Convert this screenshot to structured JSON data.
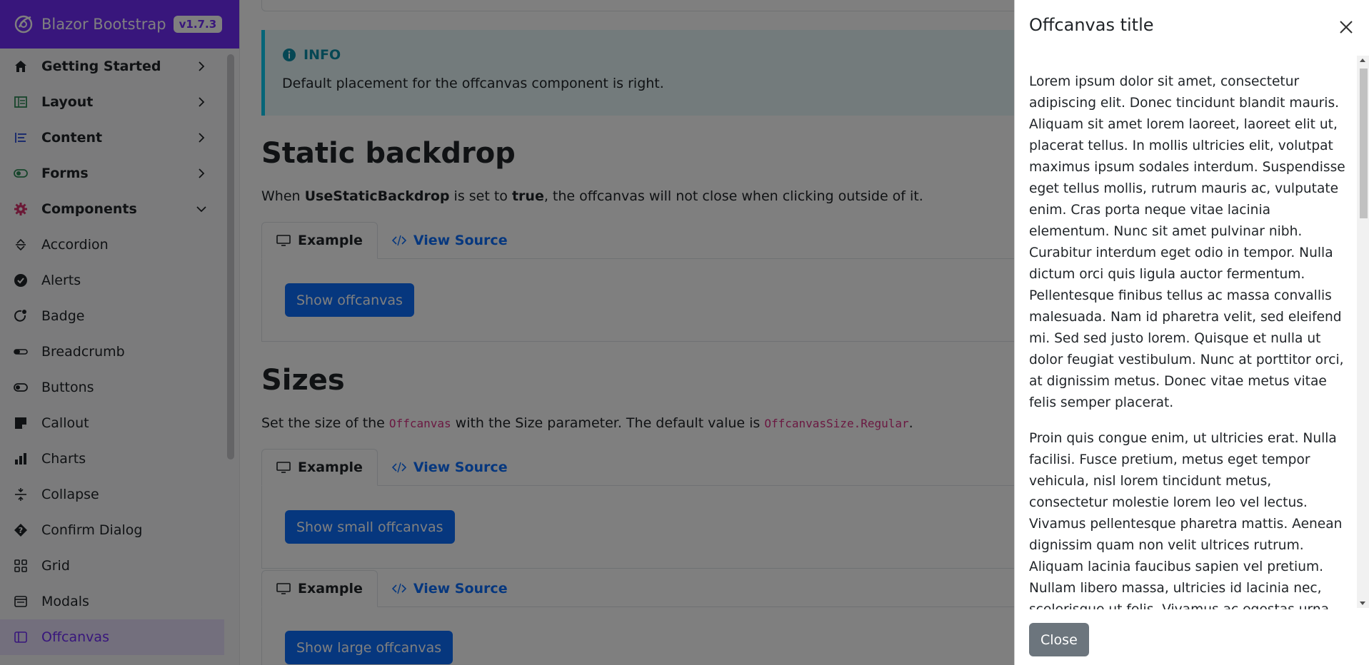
{
  "brand": {
    "name": "Blazor Bootstrap",
    "version": "v1.7.3"
  },
  "sidebar": {
    "items": [
      {
        "label": "Getting Started",
        "icon": "home-icon",
        "group": true,
        "expanded": false
      },
      {
        "label": "Layout",
        "icon": "layout-icon",
        "group": true,
        "expanded": false
      },
      {
        "label": "Content",
        "icon": "content-icon",
        "group": true,
        "expanded": false
      },
      {
        "label": "Forms",
        "icon": "forms-icon",
        "group": true,
        "expanded": false
      },
      {
        "label": "Components",
        "icon": "gear-icon",
        "group": true,
        "expanded": true
      },
      {
        "label": "Accordion",
        "icon": "accordion-icon"
      },
      {
        "label": "Alerts",
        "icon": "check-circle-icon"
      },
      {
        "label": "Badge",
        "icon": "badge-icon"
      },
      {
        "label": "Breadcrumb",
        "icon": "breadcrumb-icon"
      },
      {
        "label": "Buttons",
        "icon": "toggle-icon"
      },
      {
        "label": "Callout",
        "icon": "callout-icon"
      },
      {
        "label": "Charts",
        "icon": "bar-chart-icon"
      },
      {
        "label": "Collapse",
        "icon": "collapse-icon"
      },
      {
        "label": "Confirm Dialog",
        "icon": "question-diamond-icon"
      },
      {
        "label": "Grid",
        "icon": "grid-icon"
      },
      {
        "label": "Modals",
        "icon": "window-icon"
      },
      {
        "label": "Offcanvas",
        "icon": "offcanvas-icon",
        "active": true
      }
    ]
  },
  "main": {
    "callout": {
      "heading": "INFO",
      "text": "Default placement for the offcanvas component is right."
    },
    "static_backdrop": {
      "title": "Static backdrop",
      "desc_pre": "When ",
      "desc_b1": "UseStaticBackdrop",
      "desc_mid": " is set to ",
      "desc_b2": "true",
      "desc_post": ", the offcanvas will not close when clicking outside of it.",
      "tab_example": "Example",
      "tab_source": "View Source",
      "button": "Show offcanvas"
    },
    "sizes": {
      "title": "Sizes",
      "desc_pre": "Set the size of the ",
      "code1": "Offcanvas",
      "desc_mid": " with the Size parameter. The default value is ",
      "code2": "OffcanvasSize.Regular",
      "desc_post": ".",
      "tab_example": "Example",
      "tab_source": "View Source",
      "button_small": "Show small offcanvas",
      "button_large": "Show large offcanvas"
    }
  },
  "offcanvas": {
    "title": "Offcanvas title",
    "paragraph1": "Lorem ipsum dolor sit amet, consectetur adipiscing elit. Donec tincidunt blandit mauris. Aliquam sit amet lorem laoreet, laoreet elit ut, placerat tellus. In mollis ultricies elit, volutpat maximus ipsum sodales interdum. Suspendisse eget tellus mollis, rutrum mauris ac, vulputate enim. Cras porta neque vitae lacinia elementum. Nunc sit amet pulvinar nibh. Curabitur interdum eget odio in tempor. Nulla dictum orci quis ligula auctor fermentum. Pellentesque finibus tellus ac massa convallis malesuada. Nam id pharetra velit, sed eleifend mi. Sed sed justo lorem. Quisque et nulla ut dolor feugiat vestibulum. Nunc at porttitor orci, at dignissim metus. Donec vitae metus vitae felis semper placerat.",
    "paragraph2": "Proin quis congue enim, ut ultricies erat. Nulla facilisi. Fusce pretium, metus eget tempor vehicula, nisl lorem tincidunt metus, consectetur molestie lorem leo vel lectus. Vivamus pellentesque pharetra mattis. Aenean dignissim quam non velit ultrices rutrum. Aliquam lacinia faucibus sapien vel pretium. Nullam libero massa, ultricies id lacinia nec, scelerisque ut felis. Vivamus ac egestas urna, sit amet condimentum odio. Suspendisse ultrices, libero sed interdum",
    "close_button": "Close"
  },
  "colors": {
    "brand": "#712cf9",
    "primary": "#0d6efd",
    "secondary": "#6c757d",
    "info": "#0dcaf0"
  }
}
